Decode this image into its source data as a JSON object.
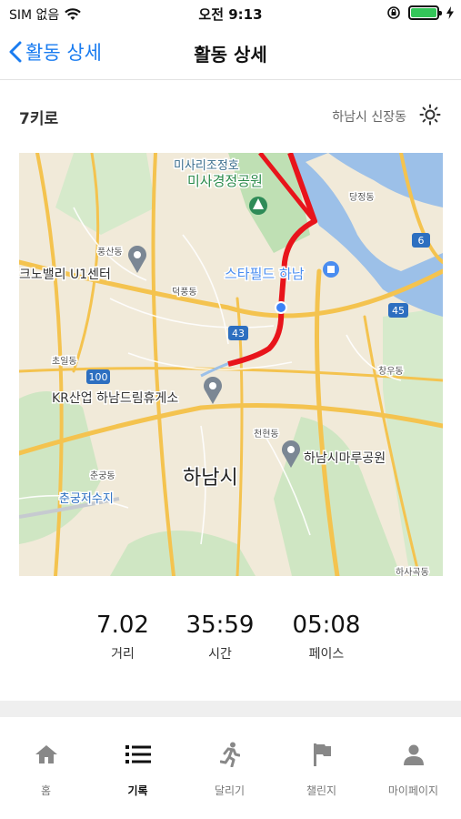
{
  "status_bar": {
    "carrier": "SIM 없음",
    "time": "오전 9:13",
    "battery_level": 1.0
  },
  "nav": {
    "back_label": "활동 상세",
    "title": "활동 상세"
  },
  "activity": {
    "name": "7키로",
    "location": "하남시 신장동",
    "weather_icon": "sun-icon"
  },
  "map": {
    "labels": {
      "misari_jeongho": "미사리조정호",
      "misa_park": "미사경정공원",
      "dangjeong": "당정동",
      "pungsan": "풍산동",
      "techno": "크노밸리 U1센터",
      "starfield": "스타필드 하남",
      "deokpung": "덕풍동",
      "chowi": "초일동",
      "changwoo": "창우동",
      "kr_rest": "KR산업 하남드림휴게소",
      "cheonhyeon": "천현동",
      "marupark": "하남시마루공원",
      "chungung": "춘궁동",
      "hanam_city": "하남시",
      "chungungji": "춘궁저수지",
      "hasan": "하사곡동",
      "route_6": "6",
      "route_45": "45",
      "route_43": "43",
      "route_100": "100"
    },
    "colors": {
      "route": "#e8141b",
      "water": "#9cc0e8",
      "park": "#bfe0b4",
      "road": "#f4c34f"
    }
  },
  "stats": [
    {
      "value": "7.02",
      "label": "거리"
    },
    {
      "value": "35:59",
      "label": "시간"
    },
    {
      "value": "05:08",
      "label": "페이스"
    }
  ],
  "tabs": [
    {
      "label": "홈",
      "icon": "home-icon"
    },
    {
      "label": "기록",
      "icon": "list-icon",
      "active": true
    },
    {
      "label": "달리기",
      "icon": "runner-icon"
    },
    {
      "label": "챌린지",
      "icon": "flag-icon"
    },
    {
      "label": "마이페이지",
      "icon": "person-icon"
    }
  ]
}
